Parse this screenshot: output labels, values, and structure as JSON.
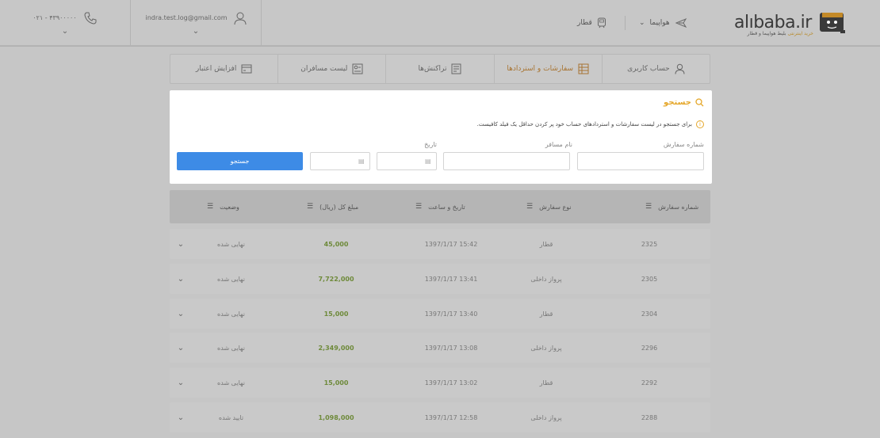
{
  "header": {
    "phone": "۰۲۱ - ۴۳۹۰۰۰۰۰",
    "email": "indra.test.log@gmail.com",
    "nav_flight": "هواپیما",
    "nav_train": "قطار",
    "logo": "alıbaba.ir",
    "logo_sub_highlight": "خرید اینترنتی",
    "logo_sub_rest": " بلیط هواپیما و قطار"
  },
  "tabs": [
    {
      "label": "حساب کاربری",
      "icon": "user-icon"
    },
    {
      "label": "سفارشات و استردادها",
      "icon": "orders-icon",
      "active": true
    },
    {
      "label": "تراکنش‌ها",
      "icon": "transactions-icon"
    },
    {
      "label": "لیست مسافران",
      "icon": "passengers-icon"
    },
    {
      "label": "افزایش اعتبار",
      "icon": "credit-card-icon"
    }
  ],
  "search": {
    "title": "جستجو",
    "info": "برای جستجو در لیست سفارشات و استردادهای حساب خود پر کردن حداقل یک فیلد کافیست.",
    "order_number_label": "شماره سفارش",
    "passenger_name_label": "نام مسافر",
    "date_label": "تاریخ",
    "button": "جستجو"
  },
  "table": {
    "columns": [
      "شماره سفارش",
      "نوع سفارش",
      "تاریخ و ساعت",
      "مبلغ کل (ریال)",
      "وضعیت"
    ],
    "rows": [
      {
        "id": "2325",
        "type": "قطار",
        "datetime": "1397/1/17 15:42",
        "amount": "45,000",
        "status": "نهایی شده"
      },
      {
        "id": "2305",
        "type": "پرواز داخلی",
        "datetime": "1397/1/17 13:41",
        "amount": "7,722,000",
        "status": "نهایی شده"
      },
      {
        "id": "2304",
        "type": "قطار",
        "datetime": "1397/1/17 13:40",
        "amount": "15,000",
        "status": "نهایی شده"
      },
      {
        "id": "2296",
        "type": "پرواز داخلی",
        "datetime": "1397/1/17 13:08",
        "amount": "2,349,000",
        "status": "نهایی شده"
      },
      {
        "id": "2292",
        "type": "قطار",
        "datetime": "1397/1/17 13:02",
        "amount": "15,000",
        "status": "نهایی شده"
      },
      {
        "id": "2288",
        "type": "پرواز داخلی",
        "datetime": "1397/1/17 12:58",
        "amount": "1,098,000",
        "status": "تایید شده"
      }
    ]
  },
  "colors": {
    "accent": "#e5a72a",
    "primary_button": "#3d8be6",
    "amount": "#6e8a3a"
  }
}
